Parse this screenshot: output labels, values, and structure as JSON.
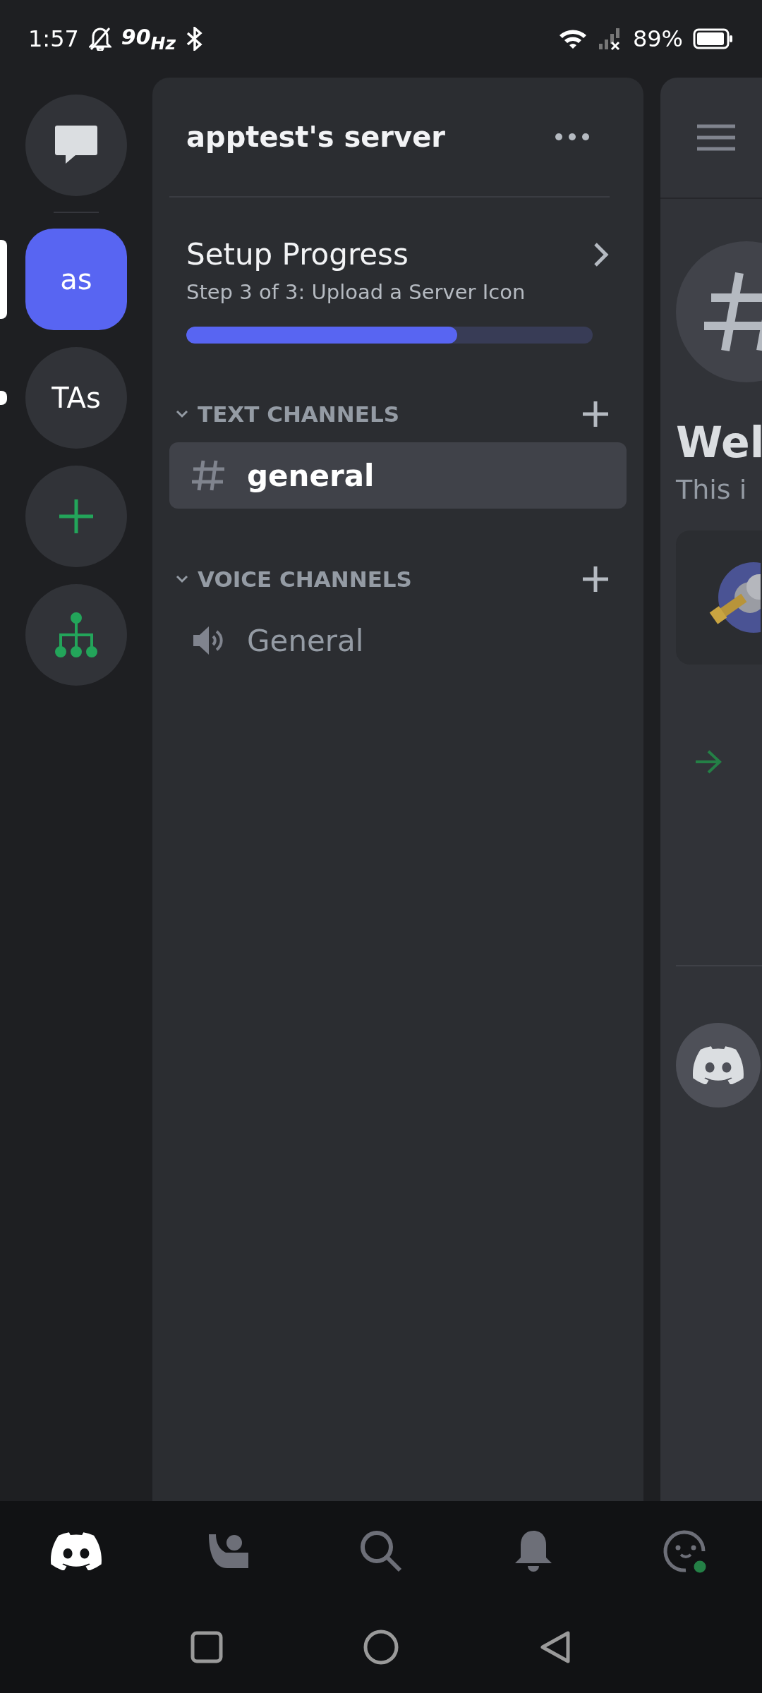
{
  "status_bar": {
    "time": "1:57",
    "refresh": "90$_{Hz}$",
    "battery": "89%"
  },
  "servers": [
    {
      "kind": "dm",
      "selected": false
    },
    {
      "kind": "server",
      "label": "as",
      "selected": true,
      "unread": false
    },
    {
      "kind": "server",
      "label": "TAs",
      "selected": false,
      "unread": true
    },
    {
      "kind": "add",
      "selected": false
    },
    {
      "kind": "discover",
      "selected": false
    }
  ],
  "server_panel": {
    "title": "apptest's server",
    "setup": {
      "title": "Setup Progress",
      "subtitle": "Step 3 of 3: Upload a Server Icon",
      "level": 0.667
    },
    "categories": [
      {
        "name": "TEXT CHANNELS",
        "expanded": true,
        "channels": [
          {
            "kind": "text",
            "name": "general",
            "selected": true
          }
        ]
      },
      {
        "name": "VOICE CHANNELS",
        "expanded": true,
        "channels": [
          {
            "kind": "voice",
            "name": "General",
            "selected": false
          }
        ]
      }
    ]
  },
  "chat_peek": {
    "heading": "Wel",
    "text": "This i"
  },
  "bottom_nav": [
    {
      "kind": "home",
      "selected": true
    },
    {
      "kind": "friends",
      "selected": false
    },
    {
      "kind": "search",
      "selected": false
    },
    {
      "kind": "notifications",
      "selected": false
    },
    {
      "kind": "profile",
      "selected": false
    }
  ]
}
